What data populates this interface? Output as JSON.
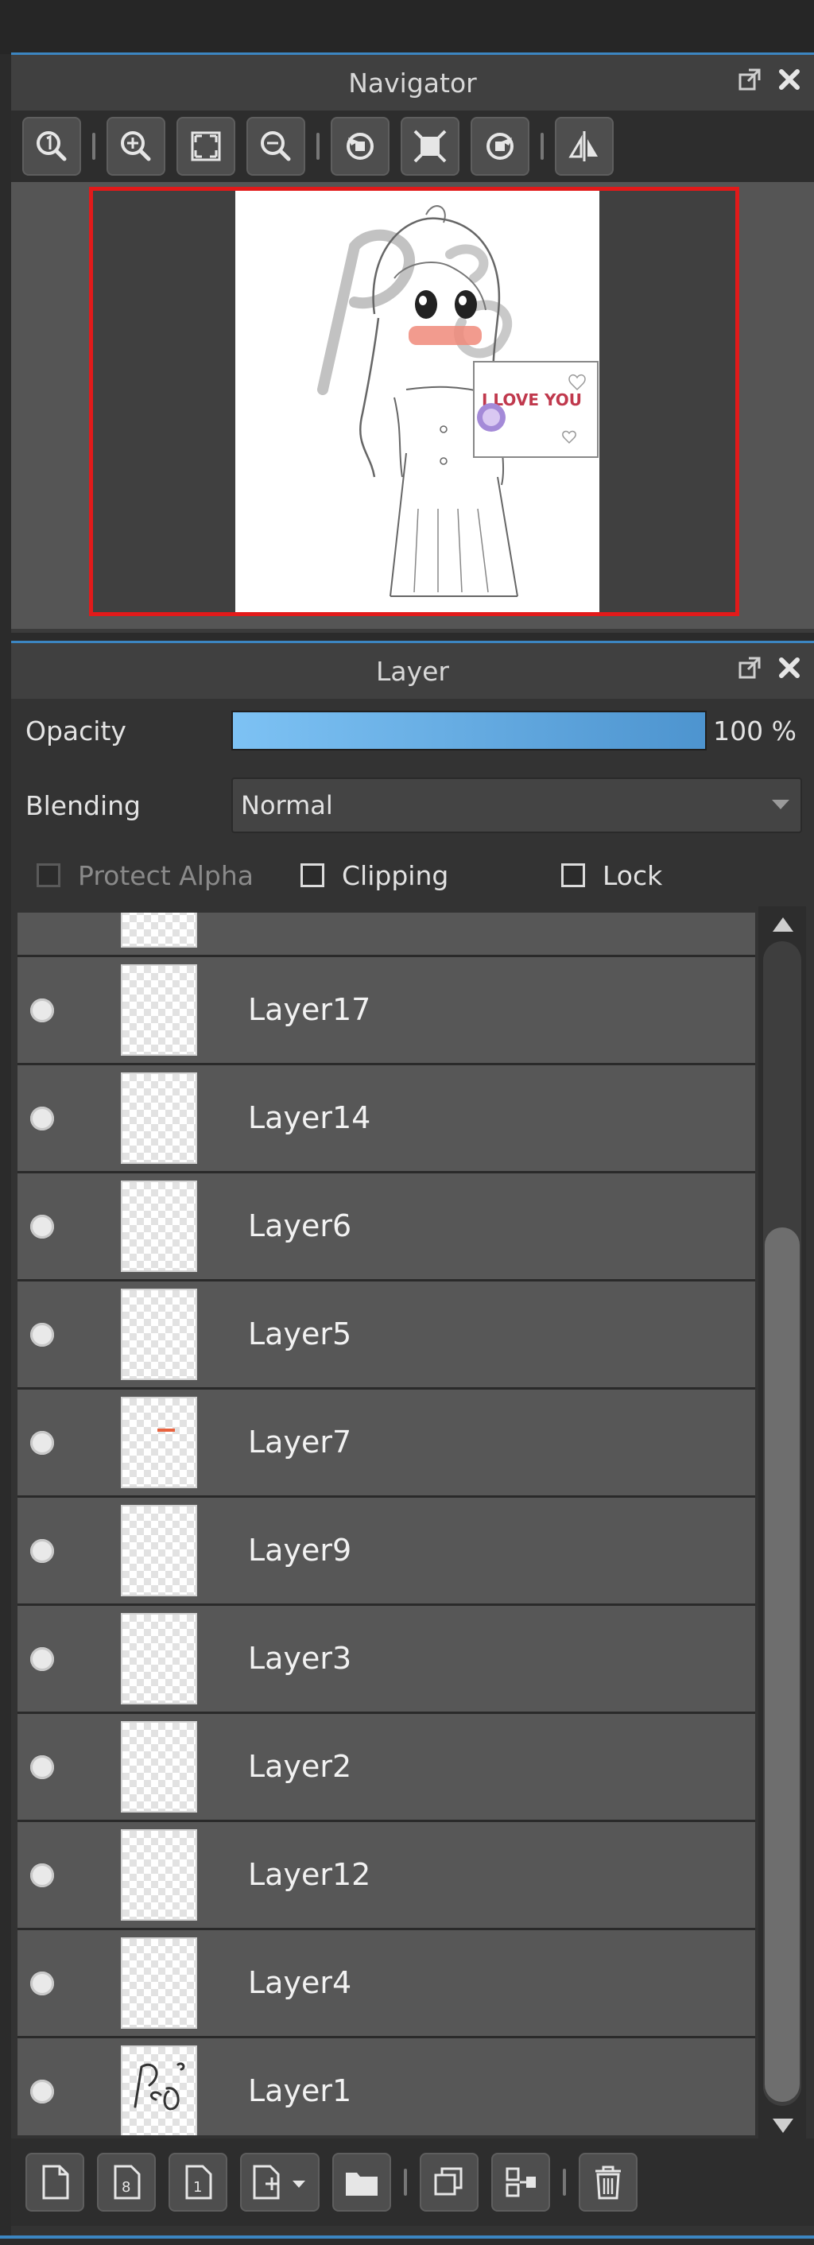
{
  "navigator": {
    "title": "Navigator",
    "toolbar_icons": [
      "zoom-actual-icon",
      "zoom-in-icon",
      "fit-screen-icon",
      "zoom-out-icon",
      "rotate-left-icon",
      "fit-page-icon",
      "rotate-right-icon",
      "flip-horizontal-icon"
    ],
    "preview": {
      "sign_text": "I LOVE YOU",
      "watermark_text": "Peo"
    }
  },
  "layer_panel": {
    "title": "Layer",
    "opacity_label": "Opacity",
    "opacity_value": "100 %",
    "opacity_fraction": 1.0,
    "blending_label": "Blending",
    "blending_value": "Normal",
    "protect_alpha_label": "Protect Alpha",
    "clipping_label": "Clipping",
    "lock_label": "Lock",
    "layers": [
      {
        "name": "Layer17"
      },
      {
        "name": "Layer14"
      },
      {
        "name": "Layer6"
      },
      {
        "name": "Layer5"
      },
      {
        "name": "Layer7"
      },
      {
        "name": "Layer9"
      },
      {
        "name": "Layer3"
      },
      {
        "name": "Layer2"
      },
      {
        "name": "Layer12"
      },
      {
        "name": "Layer4"
      },
      {
        "name": "Layer1"
      }
    ]
  },
  "bottom_toolbar": [
    "new-layer-icon",
    "8bit-layer-icon",
    "1bit-layer-icon",
    "add-layer-menu-icon",
    "folder-icon",
    "duplicate-icon",
    "merge-down-icon",
    "trash-icon"
  ],
  "colors": {
    "accent": "#3c86c2",
    "preview_border": "#e21a1a",
    "opacity_bar": "#5aa6e2"
  }
}
